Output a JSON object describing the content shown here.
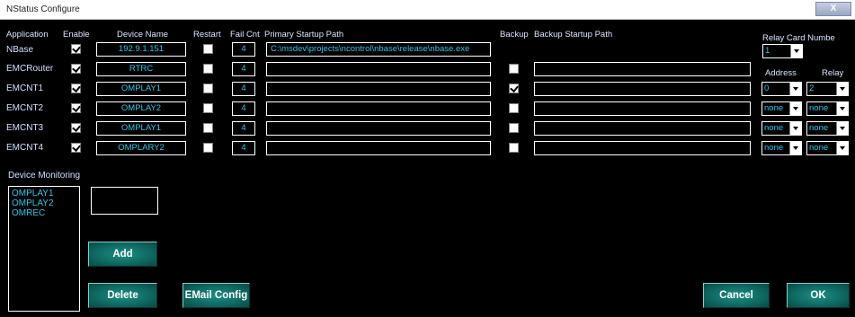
{
  "window": {
    "title": "NStatus Configure",
    "close_label": "X"
  },
  "headers": {
    "application": "Application",
    "enable": "Enable",
    "device_name": "Device Name",
    "restart": "Restart",
    "fail_cnt": "Fail Cnt",
    "primary_path": "Primary Startup Path",
    "backup": "Backup",
    "backup_path": "Backup Startup Path",
    "relay_card_number": "Relay Card Numbe",
    "address": "Address",
    "relay": "Relay"
  },
  "relay_card_value": "1",
  "rows": [
    {
      "app": "NBase",
      "enable": true,
      "device": "192.9.1.151",
      "restart": false,
      "fail_cnt": "4",
      "primary": "C:\\msdev\\projects\\ncontrol\\nbase\\release\\nbase.exe",
      "backup": null,
      "backup_path": null,
      "address": null,
      "relay": null
    },
    {
      "app": "EMCRouter",
      "enable": true,
      "device": "RTRC",
      "restart": false,
      "fail_cnt": "4",
      "primary": "",
      "backup": false,
      "backup_path": "",
      "address": null,
      "relay": null
    },
    {
      "app": "EMCNT1",
      "enable": true,
      "device": "OMPLAY1",
      "restart": false,
      "fail_cnt": "4",
      "primary": "",
      "backup": true,
      "backup_path": "",
      "address": "0",
      "relay": "2"
    },
    {
      "app": "EMCNT2",
      "enable": true,
      "device": "OMPLAY2",
      "restart": false,
      "fail_cnt": "4",
      "primary": "",
      "backup": false,
      "backup_path": "",
      "address": "none",
      "relay": "none"
    },
    {
      "app": "EMCNT3",
      "enable": true,
      "device": "OMPLAY1",
      "restart": false,
      "fail_cnt": "4",
      "primary": "",
      "backup": false,
      "backup_path": "",
      "address": "none",
      "relay": "none"
    },
    {
      "app": "EMCNT4",
      "enable": true,
      "device": "OMPLARY2",
      "restart": false,
      "fail_cnt": "4",
      "primary": "",
      "backup": false,
      "backup_path": "",
      "address": "none",
      "relay": "none"
    }
  ],
  "monitoring": {
    "label": "Device Monitoring",
    "items": [
      "OMPLAY1",
      "OMPLAY2",
      "OMREC"
    ],
    "new_device_value": ""
  },
  "buttons": {
    "add": "Add",
    "delete": "Delete",
    "email_config": "EMail Config",
    "cancel": "Cancel",
    "ok": "OK"
  }
}
